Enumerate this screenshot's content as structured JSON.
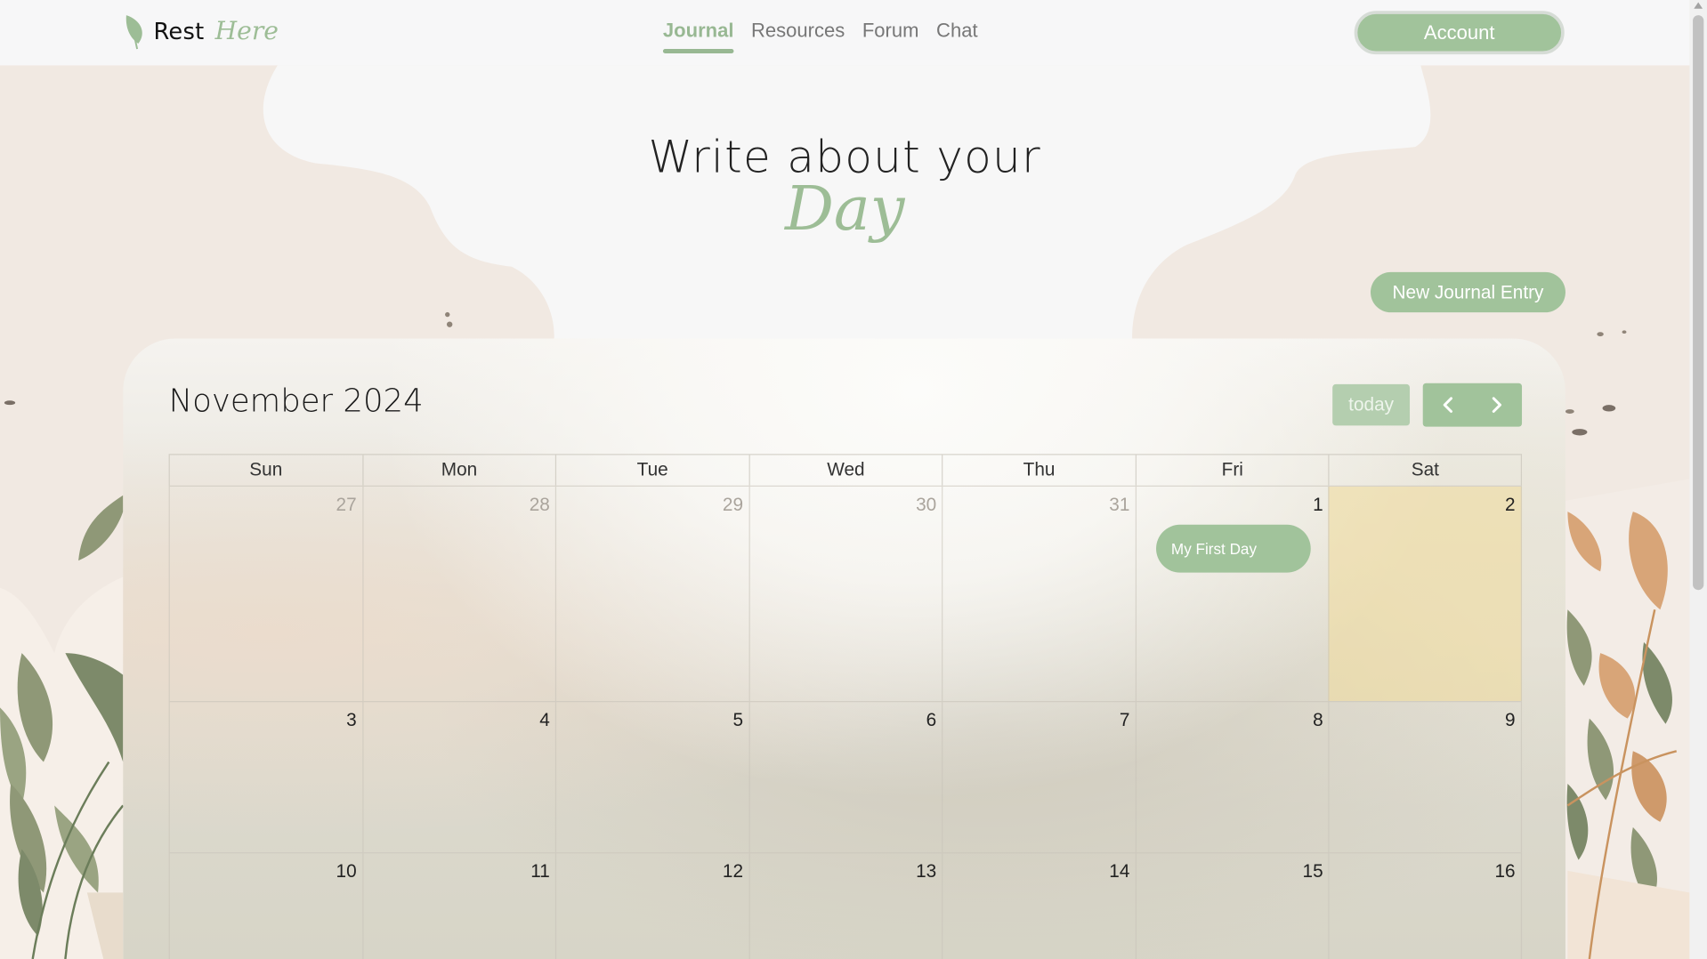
{
  "brand": {
    "name_part1": "Rest",
    "name_part2": "Here",
    "logo_icon": "leaf-icon"
  },
  "nav": {
    "links": [
      {
        "label": "Journal",
        "active": true
      },
      {
        "label": "Resources",
        "active": false
      },
      {
        "label": "Forum",
        "active": false
      },
      {
        "label": "Chat",
        "active": false
      }
    ],
    "account_label": "Account"
  },
  "hero": {
    "line1": "Write about your",
    "line2": "Day"
  },
  "new_entry_label": "New Journal Entry",
  "calendar": {
    "title": "November 2024",
    "today_label": "today",
    "prev_icon": "chevron-left-icon",
    "next_icon": "chevron-right-icon",
    "weekdays": [
      "Sun",
      "Mon",
      "Tue",
      "Wed",
      "Thu",
      "Fri",
      "Sat"
    ],
    "weeks": [
      [
        {
          "num": "27",
          "other": true
        },
        {
          "num": "28",
          "other": true
        },
        {
          "num": "29",
          "other": true
        },
        {
          "num": "30",
          "other": true
        },
        {
          "num": "31",
          "other": true
        },
        {
          "num": "1",
          "other": false,
          "event": "My First Day"
        },
        {
          "num": "2",
          "other": false,
          "today": true
        }
      ],
      [
        {
          "num": "3"
        },
        {
          "num": "4"
        },
        {
          "num": "5"
        },
        {
          "num": "6"
        },
        {
          "num": "7"
        },
        {
          "num": "8"
        },
        {
          "num": "9"
        }
      ],
      [
        {
          "num": "10"
        },
        {
          "num": "11"
        },
        {
          "num": "12"
        },
        {
          "num": "13"
        },
        {
          "num": "14"
        },
        {
          "num": "15"
        },
        {
          "num": "16"
        }
      ]
    ]
  },
  "colors": {
    "accent": "#a1c39b",
    "accent_light": "#b4ceaf",
    "today_highlight": "#f0dca0",
    "background": "#f2ebe4"
  }
}
